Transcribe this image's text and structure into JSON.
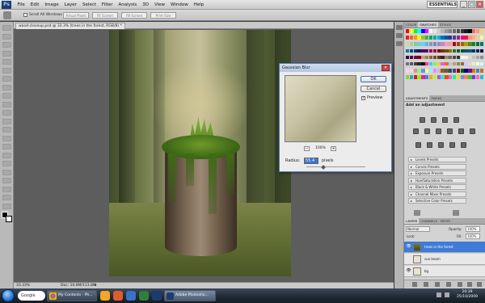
{
  "app": {
    "logo": "Ps"
  },
  "menu": [
    "File",
    "Edit",
    "Image",
    "Layer",
    "Select",
    "Filter",
    "Analysis",
    "3D",
    "View",
    "Window",
    "Help"
  ],
  "workspace": {
    "label": "ESSENTIALS ▾"
  },
  "window_controls": {
    "minimize": "_",
    "maximize": "□",
    "close": "✕"
  },
  "options": {
    "scroll_all_windows": "Scroll All Windows",
    "actual_pixels": "Actual Pixels",
    "fit_screen": "Fit Screen",
    "fill_screen": "Fill Screen",
    "print_size": "Print Size"
  },
  "document": {
    "tab": "wood-closeup.psd @ 33.3% (trees in the forest, RGB/8) *",
    "zoom": "33.33%",
    "doc_info": "Doc: 10.8M/113.8M"
  },
  "gaussian_blur": {
    "title": "Gaussian Blur",
    "ok": "OK",
    "cancel": "Cancel",
    "preview_label": "Preview",
    "preview_check": "✓",
    "zoom_out": "−",
    "zoom_in": "+",
    "zoom_value": "100%",
    "radius_label": "Radius:",
    "radius_value": "55.4",
    "radius_unit": "pixels",
    "close": "✕"
  },
  "panel_tabs_top": [
    "COLOR",
    "SWATCHES",
    "STYLES"
  ],
  "swatch_colors": [
    "#ff0000",
    "#ffff00",
    "#00ff00",
    "#00ffff",
    "#0000ff",
    "#ff00ff",
    "#ffffff",
    "#e6e6e6",
    "#cccccc",
    "#b3b3b3",
    "#999999",
    "#808080",
    "#666666",
    "#4d4d4d",
    "#333333",
    "#1a1a1a",
    "#000000",
    "#ff6666",
    "#ff9966",
    "#ffcc66",
    "#ee1c24",
    "#f26522",
    "#f7941d",
    "#fff200",
    "#8dc63f",
    "#39b54a",
    "#00a651",
    "#00a99d",
    "#00aeef",
    "#0072bc",
    "#0054a6",
    "#2e3192",
    "#662d91",
    "#92278f",
    "#ec008c",
    "#ed145b",
    "#f69679",
    "#f9ad81",
    "#fdc68a",
    "#fff799",
    "#c4df9b",
    "#a3d39c",
    "#82ca9c",
    "#7accc8",
    "#6dcff6",
    "#7da7d9",
    "#8393ca",
    "#8781bd",
    "#a186be",
    "#bd8cbf",
    "#f49ac2",
    "#f6989d",
    "#9e0b0f",
    "#a0410d",
    "#a36209",
    "#aba000",
    "#598527",
    "#1a7b30",
    "#007236",
    "#00746b",
    "#0076a3",
    "#004b80",
    "#003471",
    "#1b1464",
    "#440e62",
    "#630460",
    "#9e005d",
    "#9e0039",
    "#790000",
    "#7b2e00",
    "#7d4900",
    "#827b00",
    "#406618",
    "#005e20",
    "#005826",
    "#005952",
    "#005b7f",
    "#003663",
    "#002157",
    "#0d004c",
    "#32004b",
    "#4b0049",
    "#7b0046",
    "#7a0026",
    "#c69c6d",
    "#a67c52",
    "#8c6239",
    "#754c24",
    "#603913",
    "#3c2415",
    "#998675",
    "#736357",
    "#534741",
    "#362f2d",
    "#ffffff",
    "#f2f2f2",
    "#d9d9d9",
    "#bfbfbf",
    "#a6a6a6",
    "#8c8c8c",
    "#737373",
    "#595959",
    "#404040",
    "#262626",
    "#0d0d0d",
    "#ff3399",
    "#33ccff",
    "#66ff66",
    "#ffcc00",
    "#cc66ff",
    "#ff6600",
    "#99ccff",
    "#cc9966",
    "#669966",
    "#996633",
    "#ccccff",
    "#ffcccc",
    "#ccffcc",
    "#ffffcc",
    "#ccffff",
    "#ffccff",
    "#e0e0e0",
    "#ff8080",
    "#80ff80",
    "#8080ff",
    "#ffff80",
    "#80ffff",
    "#ff80ff",
    "#c0c0c0",
    "#a0522d",
    "#556b2f",
    "#2f4f4f",
    "#483d8b",
    "#8b0000",
    "#006400",
    "#00008b",
    "#8b008b",
    "#b8860b",
    "#4682b4",
    "#d2691e",
    "#9acd32",
    "#20b2aa",
    "#dc143c",
    "#7fff00",
    "#ff1493",
    "#1e90ff",
    "#ffa500",
    "#adff2f",
    "#ba55d3",
    "#40e0d0",
    "#ff4500",
    "#da70d6",
    "#00fa9a",
    "#ffd700",
    "#6495ed",
    "#ff7f50",
    "#32cd32",
    "#8a2be2",
    "#ff69b4",
    "#00ced1"
  ],
  "panel_tabs_mid": [
    "ADJUSTMENTS",
    "MASKS"
  ],
  "adjustments": {
    "title": "Add an adjustment",
    "presets": [
      "Levels Presets",
      "Curves Presets",
      "Exposure Presets",
      "Hue/Saturation Presets",
      "Black & White Presets",
      "Channel Mixer Presets",
      "Selective Color Presets"
    ]
  },
  "panel_tabs_bottom": [
    "LAYERS",
    "CHANNELS",
    "PATHS"
  ],
  "layers_panel": {
    "blend_mode": "Normal",
    "opacity_label": "Opacity:",
    "opacity": "100%",
    "lock_label": "Lock:",
    "fill_label": "Fill:",
    "fill": "100%",
    "layers": [
      {
        "name": "trees in the forest",
        "visible": "👁",
        "selected": true
      },
      {
        "name": "sun beam",
        "visible": "",
        "selected": false
      },
      {
        "name": "bg",
        "visible": "👁",
        "selected": false
      }
    ]
  },
  "taskbar": {
    "google_label": "Google",
    "chrome_item": "My Contents - Ph...",
    "photoshop_item": "Adobe Photosho...",
    "time": "20:39",
    "date": "25/10/2009"
  },
  "tool_icons": [
    "move-tool",
    "marquee-tool",
    "lasso-tool",
    "quick-select-tool",
    "crop-tool",
    "eyedropper-tool",
    "healing-tool",
    "brush-tool",
    "clone-tool",
    "history-brush-tool",
    "eraser-tool",
    "gradient-tool",
    "blur-tool",
    "dodge-tool",
    "pen-tool",
    "type-tool",
    "path-select-tool",
    "shape-tool",
    "3d-rotate-tool",
    "3d-orbit-tool",
    "hand-tool",
    "zoom-tool"
  ]
}
